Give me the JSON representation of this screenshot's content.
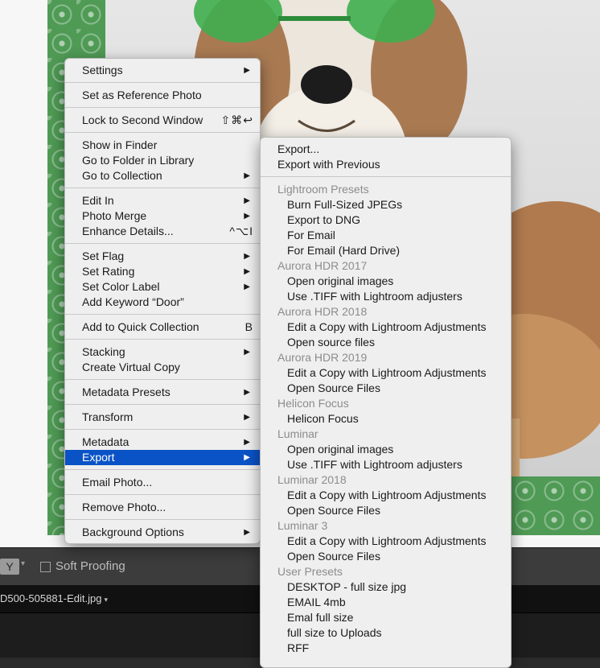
{
  "context_menu": {
    "groups": [
      [
        {
          "label": "Settings",
          "submenu": true
        }
      ],
      [
        {
          "label": "Set as Reference Photo"
        }
      ],
      [
        {
          "label": "Lock to Second Window",
          "shortcut": "⇧⌘↩"
        }
      ],
      [
        {
          "label": "Show in Finder"
        },
        {
          "label": "Go to Folder in Library"
        },
        {
          "label": "Go to Collection",
          "submenu": true
        }
      ],
      [
        {
          "label": "Edit In",
          "submenu": true
        },
        {
          "label": "Photo Merge",
          "submenu": true
        },
        {
          "label": "Enhance Details...",
          "shortcut": "^⌥I"
        }
      ],
      [
        {
          "label": "Set Flag",
          "submenu": true
        },
        {
          "label": "Set Rating",
          "submenu": true
        },
        {
          "label": "Set Color Label",
          "submenu": true
        },
        {
          "label": "Add Keyword “Door”"
        }
      ],
      [
        {
          "label": "Add to Quick Collection",
          "shortcut": "B"
        }
      ],
      [
        {
          "label": "Stacking",
          "submenu": true
        },
        {
          "label": "Create Virtual Copy"
        }
      ],
      [
        {
          "label": "Metadata Presets",
          "submenu": true
        }
      ],
      [
        {
          "label": "Transform",
          "submenu": true
        }
      ],
      [
        {
          "label": "Metadata",
          "submenu": true
        },
        {
          "label": "Export",
          "submenu": true,
          "selected": true
        }
      ],
      [
        {
          "label": "Email Photo..."
        }
      ],
      [
        {
          "label": "Remove Photo..."
        }
      ],
      [
        {
          "label": "Background Options",
          "submenu": true
        }
      ]
    ]
  },
  "export_submenu": {
    "top_items": [
      "Export...",
      "Export with Previous"
    ],
    "sections": [
      {
        "header": "Lightroom Presets",
        "items": [
          "Burn Full-Sized JPEGs",
          "Export to DNG",
          "For Email",
          "For Email (Hard Drive)"
        ]
      },
      {
        "header": "Aurora HDR 2017",
        "items": [
          "Open original images",
          "Use .TIFF with Lightroom adjusters"
        ]
      },
      {
        "header": "Aurora HDR 2018",
        "items": [
          "Edit a Copy with Lightroom Adjustments",
          "Open source files"
        ]
      },
      {
        "header": "Aurora HDR 2019",
        "items": [
          "Edit a Copy with Lightroom Adjustments",
          "Open Source Files"
        ]
      },
      {
        "header": "Helicon Focus",
        "items": [
          "Helicon Focus"
        ]
      },
      {
        "header": "Luminar",
        "items": [
          "Open original images",
          "Use .TIFF with Lightroom adjusters"
        ]
      },
      {
        "header": "Luminar 2018",
        "items": [
          "Edit a Copy with Lightroom Adjustments",
          "Open Source Files"
        ]
      },
      {
        "header": "Luminar 3",
        "items": [
          "Edit a Copy with Lightroom Adjustments",
          "Open Source Files"
        ]
      },
      {
        "header": "User Presets",
        "items": [
          "DESKTOP - full size jpg",
          "EMAIL 4mb",
          "Emal full size",
          "full size to Uploads",
          "RFF"
        ]
      }
    ]
  },
  "toolbar": {
    "view_mode_label": "Y",
    "soft_proofing_label": "Soft Proofing",
    "soft_proofing_checked": false
  },
  "filmstrip": {
    "filename": "D500-505881-Edit.jpg"
  },
  "colors": {
    "menu_bg": "#efefef",
    "selection": "#0a53c7",
    "frame_green": "#4f9a55",
    "section_header": "#8c8c8c"
  },
  "icons": {
    "submenu_arrow": "▶",
    "dropdown_arrow": "▾"
  }
}
